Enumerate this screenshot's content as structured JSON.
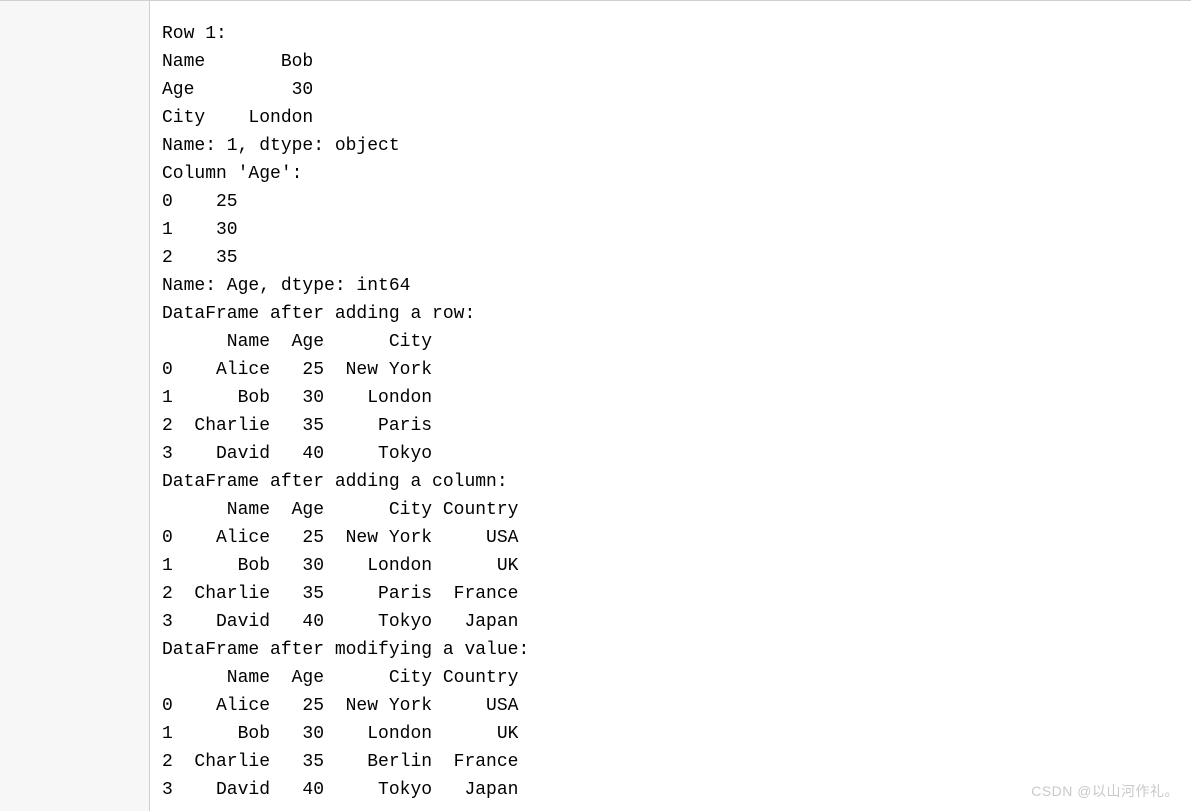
{
  "watermark": "CSDN @以山河作礼。",
  "lines": [
    "Row 1:",
    "Name       Bob",
    "Age         30",
    "City    London",
    "Name: 1, dtype: object",
    "Column 'Age':",
    "0    25",
    "1    30",
    "2    35",
    "Name: Age, dtype: int64",
    "DataFrame after adding a row:",
    "      Name  Age      City",
    "0    Alice   25  New York",
    "1      Bob   30    London",
    "2  Charlie   35     Paris",
    "3    David   40     Tokyo",
    "DataFrame after adding a column:",
    "      Name  Age      City Country",
    "0    Alice   25  New York     USA",
    "1      Bob   30    London      UK",
    "2  Charlie   35     Paris  France",
    "3    David   40     Tokyo   Japan",
    "DataFrame after modifying a value:",
    "      Name  Age      City Country",
    "0    Alice   25  New York     USA",
    "1      Bob   30    London      UK",
    "2  Charlie   35    Berlin  France",
    "3    David   40     Tokyo   Japan"
  ],
  "chart_data": {
    "type": "table",
    "sections": [
      {
        "title": "Row 1:",
        "kind": "series",
        "index": [
          "Name",
          "Age",
          "City"
        ],
        "values": [
          "Bob",
          30,
          "London"
        ],
        "name": "1",
        "dtype": "object"
      },
      {
        "title": "Column 'Age':",
        "kind": "series",
        "index": [
          0,
          1,
          2
        ],
        "values": [
          25,
          30,
          35
        ],
        "name": "Age",
        "dtype": "int64"
      },
      {
        "title": "DataFrame after adding a row:",
        "kind": "dataframe",
        "columns": [
          "Name",
          "Age",
          "City"
        ],
        "index": [
          0,
          1,
          2,
          3
        ],
        "rows": [
          [
            "Alice",
            25,
            "New York"
          ],
          [
            "Bob",
            30,
            "London"
          ],
          [
            "Charlie",
            35,
            "Paris"
          ],
          [
            "David",
            40,
            "Tokyo"
          ]
        ]
      },
      {
        "title": "DataFrame after adding a column:",
        "kind": "dataframe",
        "columns": [
          "Name",
          "Age",
          "City",
          "Country"
        ],
        "index": [
          0,
          1,
          2,
          3
        ],
        "rows": [
          [
            "Alice",
            25,
            "New York",
            "USA"
          ],
          [
            "Bob",
            30,
            "London",
            "UK"
          ],
          [
            "Charlie",
            35,
            "Paris",
            "France"
          ],
          [
            "David",
            40,
            "Tokyo",
            "Japan"
          ]
        ]
      },
      {
        "title": "DataFrame after modifying a value:",
        "kind": "dataframe",
        "columns": [
          "Name",
          "Age",
          "City",
          "Country"
        ],
        "index": [
          0,
          1,
          2,
          3
        ],
        "rows": [
          [
            "Alice",
            25,
            "New York",
            "USA"
          ],
          [
            "Bob",
            30,
            "London",
            "UK"
          ],
          [
            "Charlie",
            35,
            "Berlin",
            "France"
          ],
          [
            "David",
            40,
            "Tokyo",
            "Japan"
          ]
        ]
      }
    ]
  }
}
